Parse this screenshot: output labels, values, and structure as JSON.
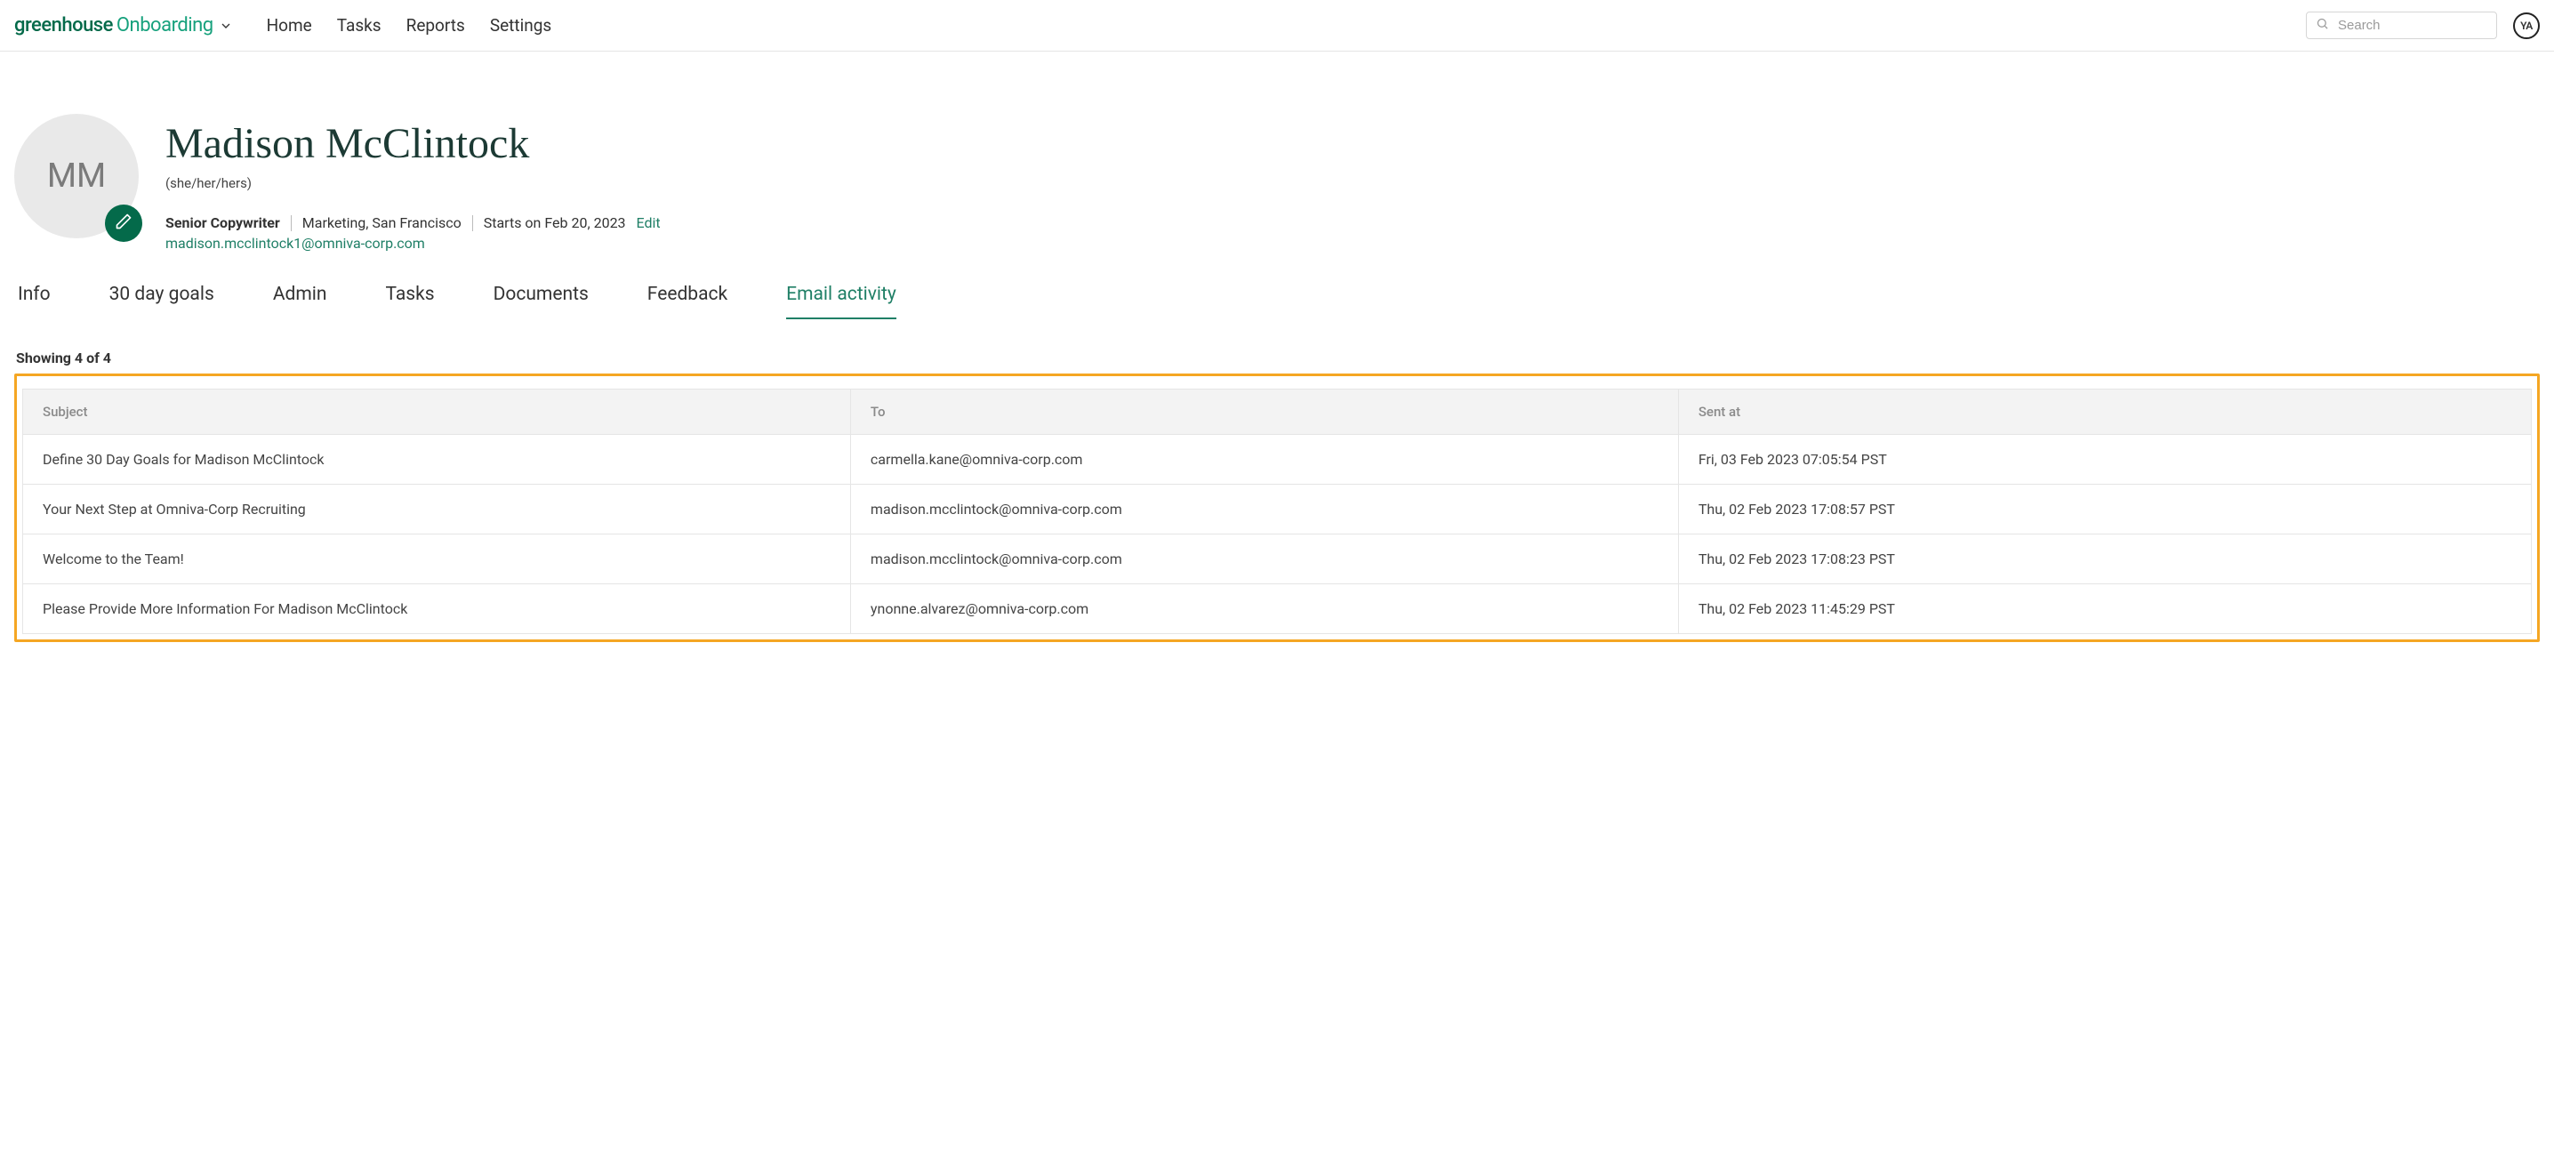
{
  "header": {
    "logo_brand": "greenhouse",
    "logo_product": "Onboarding",
    "nav": [
      "Home",
      "Tasks",
      "Reports",
      "Settings"
    ],
    "search_placeholder": "Search",
    "user_initials": "YA"
  },
  "profile": {
    "initials": "MM",
    "name": "Madison McClintock",
    "pronouns": "(she/her/hers)",
    "title": "Senior Copywriter",
    "dept_loc": "Marketing, San Francisco",
    "start": "Starts on Feb 20, 2023",
    "edit_label": "Edit",
    "email": "madison.mcclintock1@omniva-corp.com"
  },
  "tabs": [
    "Info",
    "30 day goals",
    "Admin",
    "Tasks",
    "Documents",
    "Feedback",
    "Email activity"
  ],
  "active_tab": "Email activity",
  "count_text": "Showing 4 of 4",
  "table": {
    "columns": [
      "Subject",
      "To",
      "Sent at"
    ],
    "rows": [
      {
        "subject": "Define 30 Day Goals for Madison McClintock",
        "to": "carmella.kane@omniva-corp.com",
        "sent": "Fri, 03 Feb 2023 07:05:54 PST"
      },
      {
        "subject": "Your Next Step at Omniva-Corp Recruiting",
        "to": "madison.mcclintock@omniva-corp.com",
        "sent": "Thu, 02 Feb 2023 17:08:57 PST"
      },
      {
        "subject": "Welcome to the Team!",
        "to": "madison.mcclintock@omniva-corp.com",
        "sent": "Thu, 02 Feb 2023 17:08:23 PST"
      },
      {
        "subject": "Please Provide More Information For Madison McClintock",
        "to": "ynonne.alvarez@omniva-corp.com",
        "sent": "Thu, 02 Feb 2023 11:45:29 PST"
      }
    ]
  }
}
